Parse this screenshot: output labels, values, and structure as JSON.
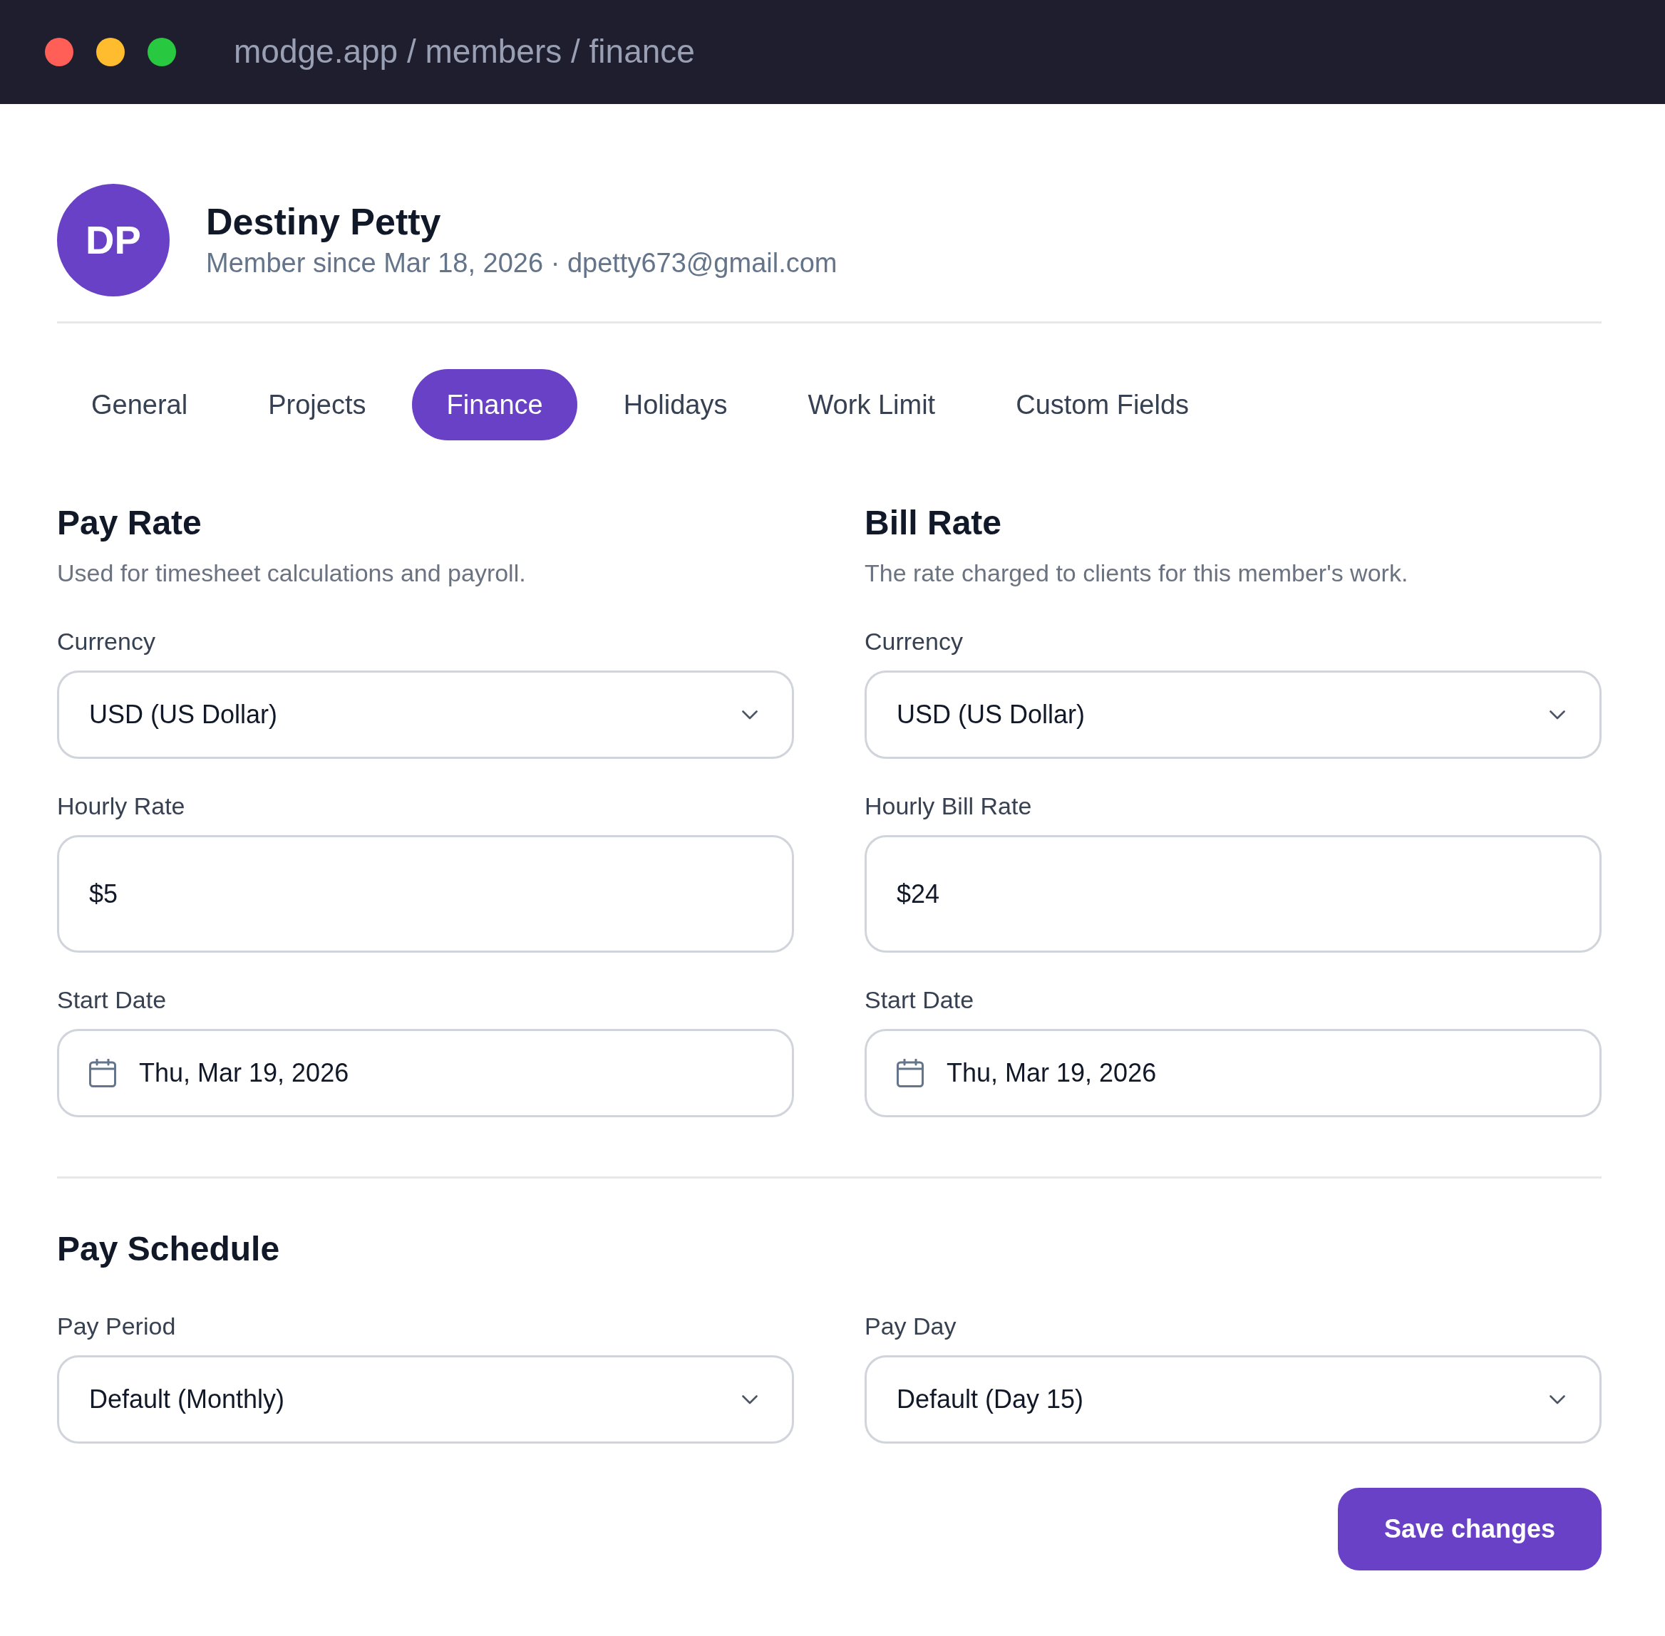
{
  "window": {
    "title": "modge.app / members / finance"
  },
  "profile": {
    "initials": "DP",
    "name": "Destiny Petty",
    "subtitle": "Member since Mar 18, 2026 · dpetty673@gmail.com"
  },
  "tabs": [
    {
      "label": "General",
      "selected": false
    },
    {
      "label": "Projects",
      "selected": false
    },
    {
      "label": "Finance",
      "selected": true
    },
    {
      "label": "Holidays",
      "selected": false
    },
    {
      "label": "Work Limit",
      "selected": false
    },
    {
      "label": "Custom Fields",
      "selected": false
    }
  ],
  "rate_sections": [
    {
      "title": "Pay Rate",
      "description": "Used for timesheet calculations and payroll.",
      "fields": [
        {
          "kind": "select",
          "label": "Currency",
          "value": "USD (US Dollar)"
        },
        {
          "kind": "text",
          "label": "Hourly Rate",
          "value": "$5"
        },
        {
          "kind": "date",
          "label": "Start Date",
          "value": "Thu, Mar 19, 2026"
        }
      ]
    },
    {
      "title": "Bill Rate",
      "description": "The rate charged to clients for this member's work.",
      "fields": [
        {
          "kind": "select",
          "label": "Currency",
          "value": "USD (US Dollar)"
        },
        {
          "kind": "text",
          "label": "Hourly Bill Rate",
          "value": "$24"
        },
        {
          "kind": "date",
          "label": "Start Date",
          "value": "Thu, Mar 19, 2026"
        }
      ]
    }
  ],
  "pay_schedule": {
    "title": "Pay Schedule",
    "fields": [
      {
        "kind": "select",
        "label": "Pay Period",
        "value": "Default (Monthly)"
      },
      {
        "kind": "select",
        "label": "Pay Day",
        "value": "Default (Day 15)"
      }
    ]
  },
  "save_button": {
    "label": "Save changes"
  }
}
